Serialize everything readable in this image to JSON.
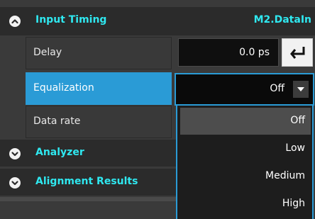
{
  "input_timing": {
    "title": "Input Timing",
    "source": "M2.DataIn",
    "expanded": true
  },
  "rows": {
    "delay_label": "Delay",
    "delay_value": "0.0 ps",
    "equalization_label": "Equalization",
    "equalization_value": "Off",
    "data_rate_label": "Data rate"
  },
  "equalization_options": [
    "Off",
    "Low",
    "Medium",
    "High"
  ],
  "equalization_highlighted": "Off",
  "sections": {
    "analyzer": "Analyzer",
    "alignment_results": "Alignment Results"
  },
  "icons": {
    "collapse": "chevron-up-icon",
    "expand": "chevron-down-icon",
    "enter": "enter-return-icon",
    "dropdown": "triangle-down-icon"
  },
  "colors": {
    "accent_cyan": "#2fe8f0",
    "selection_blue": "#2a9bd6",
    "panel": "#393939",
    "header_bg": "#2b2b2b"
  }
}
